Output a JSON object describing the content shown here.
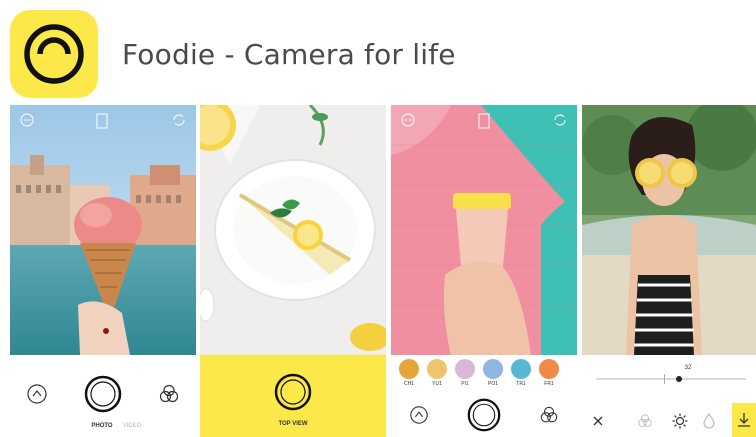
{
  "app": {
    "name": "Foodie - Camera for life",
    "icon": "foodie-logo-icon",
    "brand_color": "#fde84a"
  },
  "screens": [
    {
      "id": "photo-mode",
      "mode_labels": [
        "PHOTO",
        "VIDEO"
      ],
      "active_mode": "PHOTO",
      "icons": [
        "more-icon",
        "aspect-ratio-icon",
        "flip-camera-icon",
        "filter-icon",
        "shutter-icon",
        "effects-icon"
      ]
    },
    {
      "id": "top-view",
      "mode_label": "TOP VIEW",
      "icons": [
        "shutter-icon"
      ]
    },
    {
      "id": "filters",
      "filters": [
        "CH1",
        "YU1",
        "PI1",
        "PO1",
        "TR1",
        "FR1"
      ],
      "icons": [
        "more-icon",
        "aspect-ratio-icon",
        "flip-camera-icon",
        "filter-icon",
        "shutter-icon",
        "effects-icon"
      ]
    },
    {
      "id": "edit",
      "slider_value": "32",
      "slider_level": 0.55,
      "icons": [
        "close-icon",
        "effects-icon",
        "brightness-icon",
        "drop-icon",
        "download-icon"
      ]
    }
  ]
}
